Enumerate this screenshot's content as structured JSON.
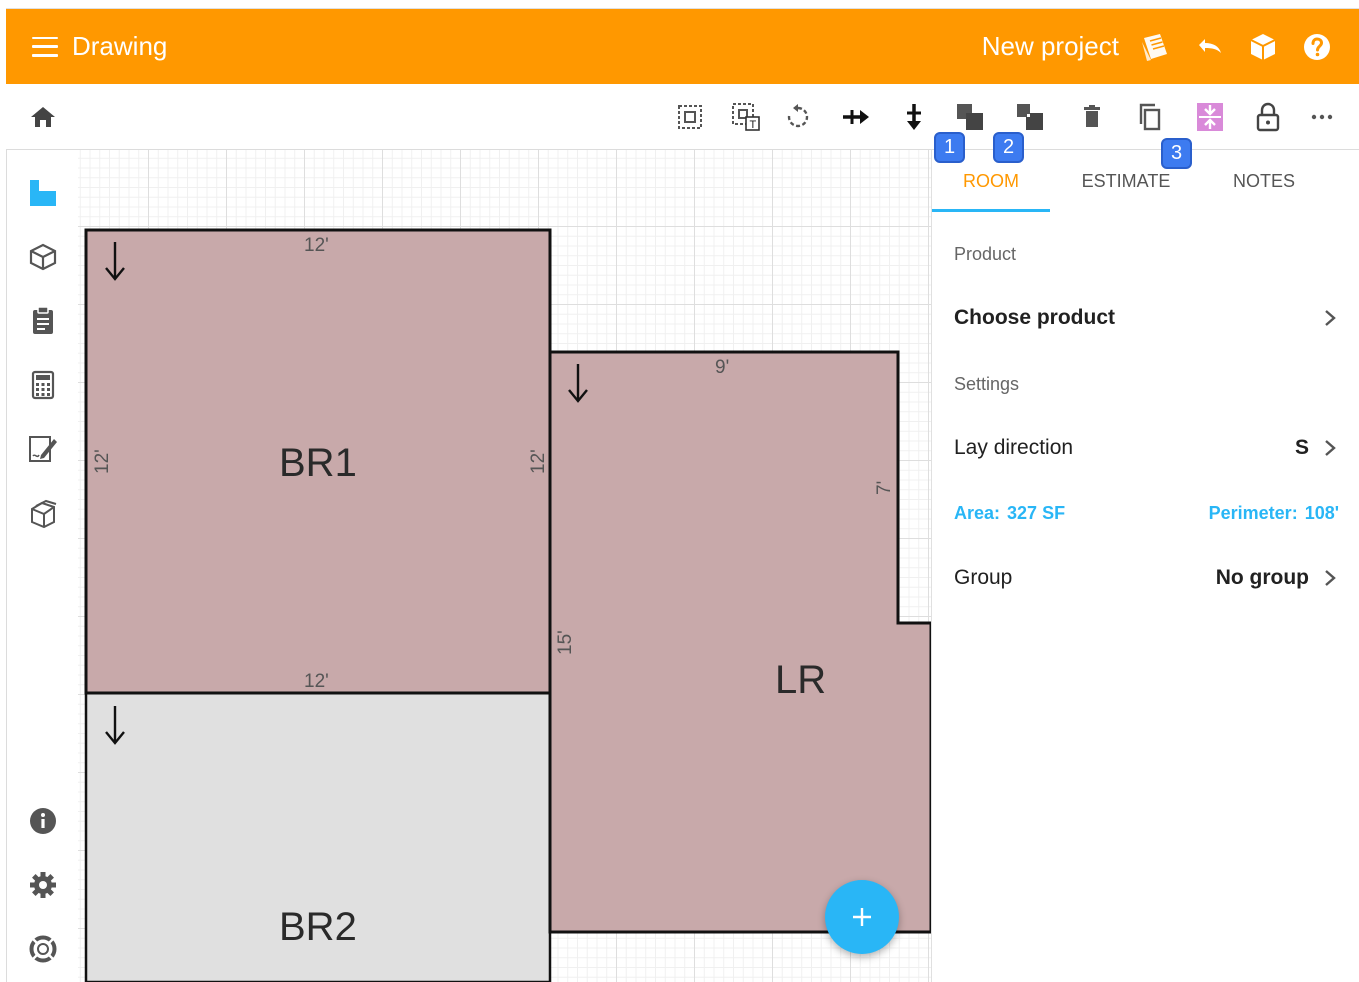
{
  "appbar": {
    "title": "Drawing",
    "project_name": "New project",
    "color": "#ff9800"
  },
  "toolbar": {
    "icons": [
      "home-icon",
      "select-icon",
      "select-text-icon",
      "rotate-icon",
      "move-right-icon",
      "move-down-icon",
      "bring-front-icon",
      "send-back-icon",
      "delete-icon",
      "copy-icon",
      "split-icon",
      "lock-icon",
      "more-icon"
    ],
    "badges": [
      "1",
      "2",
      "3"
    ]
  },
  "sidebar": {
    "icons": [
      "rooms-icon",
      "3d-icon",
      "clipboard-icon",
      "calculator-icon",
      "edit-note-icon",
      "products-icon",
      "info-icon",
      "settings-icon",
      "help-icon"
    ]
  },
  "canvas": {
    "rooms": [
      {
        "name": "BR1",
        "color": "#c8a9aa"
      },
      {
        "name": "LR",
        "color": "#c8a9aa"
      },
      {
        "name": "BR2",
        "color": "#e0e0e0"
      }
    ],
    "dimensions": {
      "br1_top": "12'",
      "br1_left": "12'",
      "br1_right": "12'",
      "br1_bottom": "12'",
      "lr_top": "9'",
      "lr_right": "7'",
      "lr_left": "15'"
    }
  },
  "panel": {
    "tabs": [
      "ROOM",
      "ESTIMATE",
      "NOTES"
    ],
    "active_tab": "ROOM",
    "product_label": "Product",
    "choose_product": "Choose product",
    "settings_label": "Settings",
    "lay_direction_label": "Lay direction",
    "lay_direction_value": "S",
    "area_label": "Area:",
    "area_value": "327 SF",
    "perimeter_label": "Perimeter:",
    "perimeter_value": "108'",
    "group_label": "Group",
    "group_value": "No group",
    "accent": "#29b6f6"
  }
}
